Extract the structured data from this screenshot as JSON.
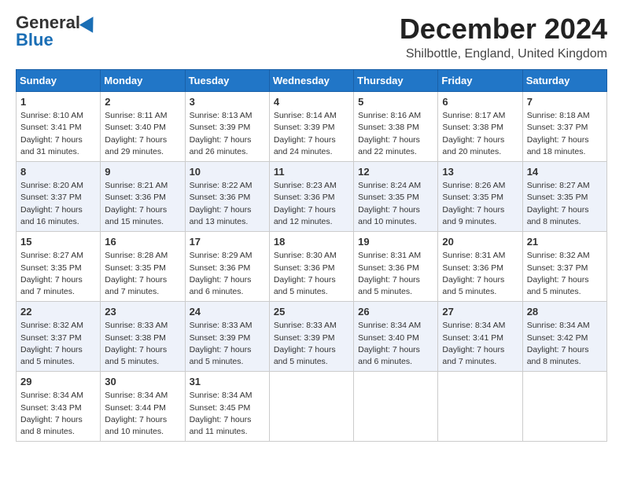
{
  "header": {
    "logo_line1": "General",
    "logo_line2": "Blue",
    "month_title": "December 2024",
    "subtitle": "Shilbottle, England, United Kingdom"
  },
  "weekdays": [
    "Sunday",
    "Monday",
    "Tuesday",
    "Wednesday",
    "Thursday",
    "Friday",
    "Saturday"
  ],
  "weeks": [
    [
      {
        "day": "1",
        "sunrise": "Sunrise: 8:10 AM",
        "sunset": "Sunset: 3:41 PM",
        "daylight": "Daylight: 7 hours and 31 minutes."
      },
      {
        "day": "2",
        "sunrise": "Sunrise: 8:11 AM",
        "sunset": "Sunset: 3:40 PM",
        "daylight": "Daylight: 7 hours and 29 minutes."
      },
      {
        "day": "3",
        "sunrise": "Sunrise: 8:13 AM",
        "sunset": "Sunset: 3:39 PM",
        "daylight": "Daylight: 7 hours and 26 minutes."
      },
      {
        "day": "4",
        "sunrise": "Sunrise: 8:14 AM",
        "sunset": "Sunset: 3:39 PM",
        "daylight": "Daylight: 7 hours and 24 minutes."
      },
      {
        "day": "5",
        "sunrise": "Sunrise: 8:16 AM",
        "sunset": "Sunset: 3:38 PM",
        "daylight": "Daylight: 7 hours and 22 minutes."
      },
      {
        "day": "6",
        "sunrise": "Sunrise: 8:17 AM",
        "sunset": "Sunset: 3:38 PM",
        "daylight": "Daylight: 7 hours and 20 minutes."
      },
      {
        "day": "7",
        "sunrise": "Sunrise: 8:18 AM",
        "sunset": "Sunset: 3:37 PM",
        "daylight": "Daylight: 7 hours and 18 minutes."
      }
    ],
    [
      {
        "day": "8",
        "sunrise": "Sunrise: 8:20 AM",
        "sunset": "Sunset: 3:37 PM",
        "daylight": "Daylight: 7 hours and 16 minutes."
      },
      {
        "day": "9",
        "sunrise": "Sunrise: 8:21 AM",
        "sunset": "Sunset: 3:36 PM",
        "daylight": "Daylight: 7 hours and 15 minutes."
      },
      {
        "day": "10",
        "sunrise": "Sunrise: 8:22 AM",
        "sunset": "Sunset: 3:36 PM",
        "daylight": "Daylight: 7 hours and 13 minutes."
      },
      {
        "day": "11",
        "sunrise": "Sunrise: 8:23 AM",
        "sunset": "Sunset: 3:36 PM",
        "daylight": "Daylight: 7 hours and 12 minutes."
      },
      {
        "day": "12",
        "sunrise": "Sunrise: 8:24 AM",
        "sunset": "Sunset: 3:35 PM",
        "daylight": "Daylight: 7 hours and 10 minutes."
      },
      {
        "day": "13",
        "sunrise": "Sunrise: 8:26 AM",
        "sunset": "Sunset: 3:35 PM",
        "daylight": "Daylight: 7 hours and 9 minutes."
      },
      {
        "day": "14",
        "sunrise": "Sunrise: 8:27 AM",
        "sunset": "Sunset: 3:35 PM",
        "daylight": "Daylight: 7 hours and 8 minutes."
      }
    ],
    [
      {
        "day": "15",
        "sunrise": "Sunrise: 8:27 AM",
        "sunset": "Sunset: 3:35 PM",
        "daylight": "Daylight: 7 hours and 7 minutes."
      },
      {
        "day": "16",
        "sunrise": "Sunrise: 8:28 AM",
        "sunset": "Sunset: 3:35 PM",
        "daylight": "Daylight: 7 hours and 7 minutes."
      },
      {
        "day": "17",
        "sunrise": "Sunrise: 8:29 AM",
        "sunset": "Sunset: 3:36 PM",
        "daylight": "Daylight: 7 hours and 6 minutes."
      },
      {
        "day": "18",
        "sunrise": "Sunrise: 8:30 AM",
        "sunset": "Sunset: 3:36 PM",
        "daylight": "Daylight: 7 hours and 5 minutes."
      },
      {
        "day": "19",
        "sunrise": "Sunrise: 8:31 AM",
        "sunset": "Sunset: 3:36 PM",
        "daylight": "Daylight: 7 hours and 5 minutes."
      },
      {
        "day": "20",
        "sunrise": "Sunrise: 8:31 AM",
        "sunset": "Sunset: 3:36 PM",
        "daylight": "Daylight: 7 hours and 5 minutes."
      },
      {
        "day": "21",
        "sunrise": "Sunrise: 8:32 AM",
        "sunset": "Sunset: 3:37 PM",
        "daylight": "Daylight: 7 hours and 5 minutes."
      }
    ],
    [
      {
        "day": "22",
        "sunrise": "Sunrise: 8:32 AM",
        "sunset": "Sunset: 3:37 PM",
        "daylight": "Daylight: 7 hours and 5 minutes."
      },
      {
        "day": "23",
        "sunrise": "Sunrise: 8:33 AM",
        "sunset": "Sunset: 3:38 PM",
        "daylight": "Daylight: 7 hours and 5 minutes."
      },
      {
        "day": "24",
        "sunrise": "Sunrise: 8:33 AM",
        "sunset": "Sunset: 3:39 PM",
        "daylight": "Daylight: 7 hours and 5 minutes."
      },
      {
        "day": "25",
        "sunrise": "Sunrise: 8:33 AM",
        "sunset": "Sunset: 3:39 PM",
        "daylight": "Daylight: 7 hours and 5 minutes."
      },
      {
        "day": "26",
        "sunrise": "Sunrise: 8:34 AM",
        "sunset": "Sunset: 3:40 PM",
        "daylight": "Daylight: 7 hours and 6 minutes."
      },
      {
        "day": "27",
        "sunrise": "Sunrise: 8:34 AM",
        "sunset": "Sunset: 3:41 PM",
        "daylight": "Daylight: 7 hours and 7 minutes."
      },
      {
        "day": "28",
        "sunrise": "Sunrise: 8:34 AM",
        "sunset": "Sunset: 3:42 PM",
        "daylight": "Daylight: 7 hours and 8 minutes."
      }
    ],
    [
      {
        "day": "29",
        "sunrise": "Sunrise: 8:34 AM",
        "sunset": "Sunset: 3:43 PM",
        "daylight": "Daylight: 7 hours and 8 minutes."
      },
      {
        "day": "30",
        "sunrise": "Sunrise: 8:34 AM",
        "sunset": "Sunset: 3:44 PM",
        "daylight": "Daylight: 7 hours and 10 minutes."
      },
      {
        "day": "31",
        "sunrise": "Sunrise: 8:34 AM",
        "sunset": "Sunset: 3:45 PM",
        "daylight": "Daylight: 7 hours and 11 minutes."
      },
      null,
      null,
      null,
      null
    ]
  ]
}
